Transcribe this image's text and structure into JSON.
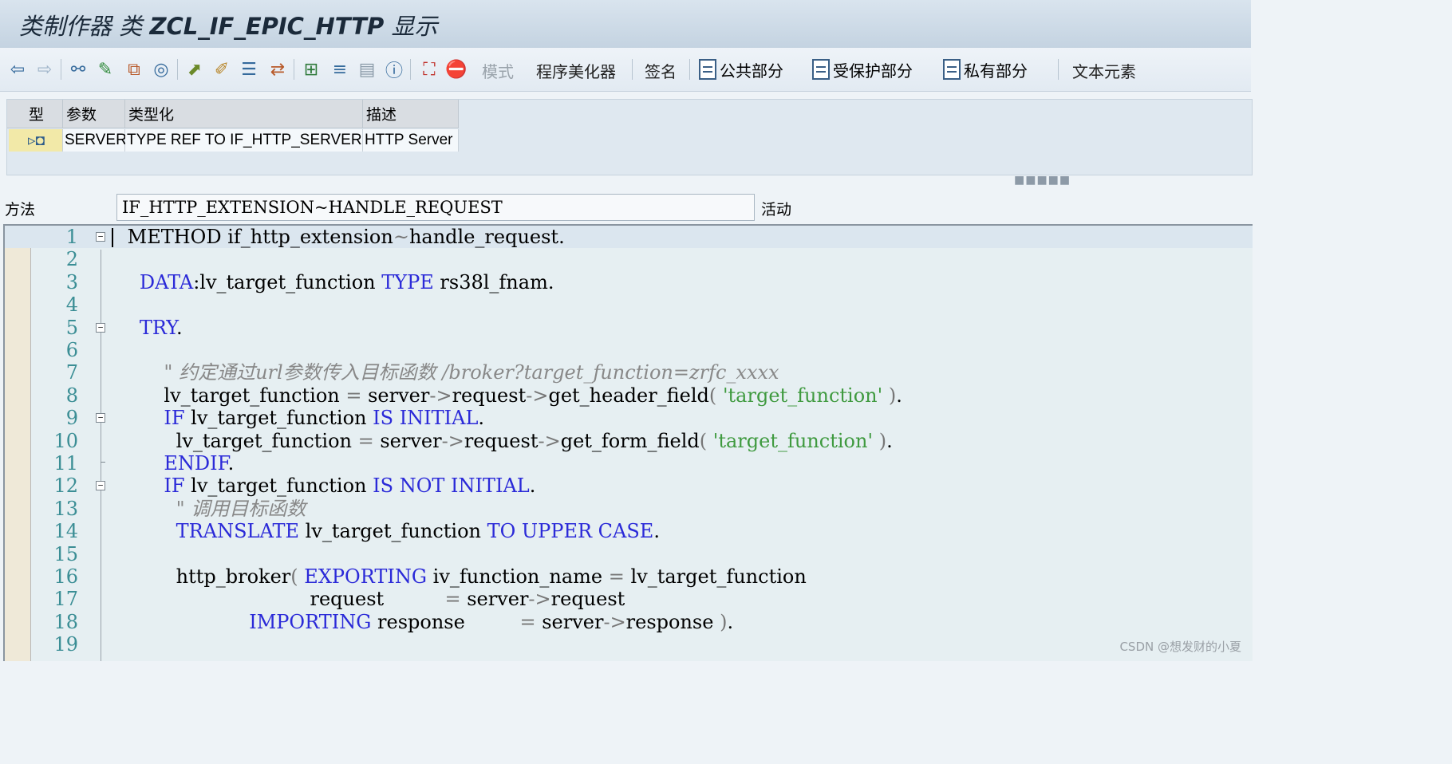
{
  "window": {
    "title_prefix": "类制作器 类",
    "title_class": "ZCL_IF_EPIC_HTTP",
    "title_suffix": "显示"
  },
  "toolbar": {
    "icons": [
      "back-icon",
      "forward-icon",
      "other-object-icon",
      "display-change-icon",
      "check-icon",
      "activate-icon",
      "where-used-icon",
      "where-used-list-icon",
      "object-list-icon",
      "navigation-window-icon",
      "display-object-list-icon",
      "hierarchy-icon",
      "layout-icon",
      "info-icon",
      "debug-icon",
      "stop-icon"
    ],
    "mode_label": "模式",
    "pretty_printer_label": "程序美化器",
    "signature_label": "签名",
    "public_section_label": "公共部分",
    "protected_section_label": "受保护部分",
    "private_section_label": "私有部分",
    "text_elements_label": "文本元素"
  },
  "params": {
    "headers": [
      "型",
      "参数",
      "类型化",
      "描述"
    ],
    "rows": [
      {
        "type_icon": "importing-icon",
        "name": "SERVER",
        "typing": "TYPE REF TO IF_HTTP_SERVER",
        "description": "HTTP Server"
      }
    ]
  },
  "method": {
    "label": "方法",
    "value": "IF_HTTP_EXTENSION~HANDLE_REQUEST",
    "status": "活动"
  },
  "editor": {
    "line_numbers": [
      "1",
      "2",
      "3",
      "4",
      "5",
      "6",
      "7",
      "8",
      "9",
      "10",
      "11",
      "12",
      "13",
      "14",
      "15",
      "16",
      "17",
      "18",
      "19"
    ],
    "lines": [
      [
        [
          "",
          " METHOD if_http_extension"
        ],
        [
          "op",
          "~"
        ],
        [
          "",
          "handle_request."
        ]
      ],
      [],
      [
        [
          "",
          "   "
        ],
        [
          "kw",
          "DATA"
        ],
        [
          "",
          ":lv_target_function "
        ],
        [
          "kw",
          "TYPE"
        ],
        [
          "",
          " rs38l_fnam."
        ]
      ],
      [],
      [
        [
          "",
          "   "
        ],
        [
          "kw",
          "TRY"
        ],
        [
          "",
          "."
        ]
      ],
      [],
      [
        [
          "",
          "       "
        ],
        [
          "cm",
          "\" 约定通过url参数传入目标函数 /broker?target_function=zrfc_xxxx"
        ]
      ],
      [
        [
          "",
          "       lv_target_function "
        ],
        [
          "op",
          "="
        ],
        [
          "",
          " server"
        ],
        [
          "op",
          "->"
        ],
        [
          "",
          "request"
        ],
        [
          "op",
          "->"
        ],
        [
          "",
          "get_header_field"
        ],
        [
          "op",
          "("
        ],
        [
          "",
          " "
        ],
        [
          "st",
          "'target_function'"
        ],
        [
          "",
          " ",
          ""
        ],
        [
          "op",
          ")"
        ],
        [
          "",
          "."
        ]
      ],
      [
        [
          "",
          "       "
        ],
        [
          "kw",
          "IF"
        ],
        [
          "",
          " lv_target_function "
        ],
        [
          "kw",
          "IS INITIAL"
        ],
        [
          "",
          "."
        ]
      ],
      [
        [
          "",
          "         lv_target_function "
        ],
        [
          "op",
          "="
        ],
        [
          "",
          " server"
        ],
        [
          "op",
          "->"
        ],
        [
          "",
          "request"
        ],
        [
          "op",
          "->"
        ],
        [
          "",
          "get_form_field"
        ],
        [
          "op",
          "("
        ],
        [
          "",
          " "
        ],
        [
          "st",
          "'target_function'"
        ],
        [
          "",
          " "
        ],
        [
          "op",
          ")"
        ],
        [
          "",
          "."
        ]
      ],
      [
        [
          "",
          "       "
        ],
        [
          "kw",
          "ENDIF"
        ],
        [
          "",
          "."
        ]
      ],
      [
        [
          "",
          "       "
        ],
        [
          "kw",
          "IF"
        ],
        [
          "",
          " lv_target_function "
        ],
        [
          "kw",
          "IS NOT INITIAL"
        ],
        [
          "",
          "."
        ]
      ],
      [
        [
          "",
          "         "
        ],
        [
          "cm",
          "\" 调用目标函数"
        ]
      ],
      [
        [
          "",
          "         "
        ],
        [
          "kw",
          "TRANSLATE"
        ],
        [
          "",
          " lv_target_function "
        ],
        [
          "kw",
          "TO UPPER CASE"
        ],
        [
          "",
          "."
        ]
      ],
      [],
      [
        [
          "",
          "         http_broker"
        ],
        [
          "op",
          "("
        ],
        [
          "",
          " "
        ],
        [
          "kw",
          "EXPORTING"
        ],
        [
          "",
          " iv_function_name "
        ],
        [
          "op",
          "="
        ],
        [
          "",
          " lv_target_function"
        ]
      ],
      [
        [
          "",
          "                               request          "
        ],
        [
          "op",
          "="
        ],
        [
          "",
          " server"
        ],
        [
          "op",
          "->"
        ],
        [
          "",
          "request"
        ]
      ],
      [
        [
          "",
          "                     "
        ],
        [
          "kw",
          "IMPORTING"
        ],
        [
          "",
          " response         "
        ],
        [
          "op",
          "="
        ],
        [
          "",
          " server"
        ],
        [
          "op",
          "->"
        ],
        [
          "",
          "response "
        ],
        [
          "op",
          ")"
        ],
        [
          "",
          "."
        ]
      ],
      []
    ]
  },
  "watermark": "CSDN @想发财的小夏"
}
